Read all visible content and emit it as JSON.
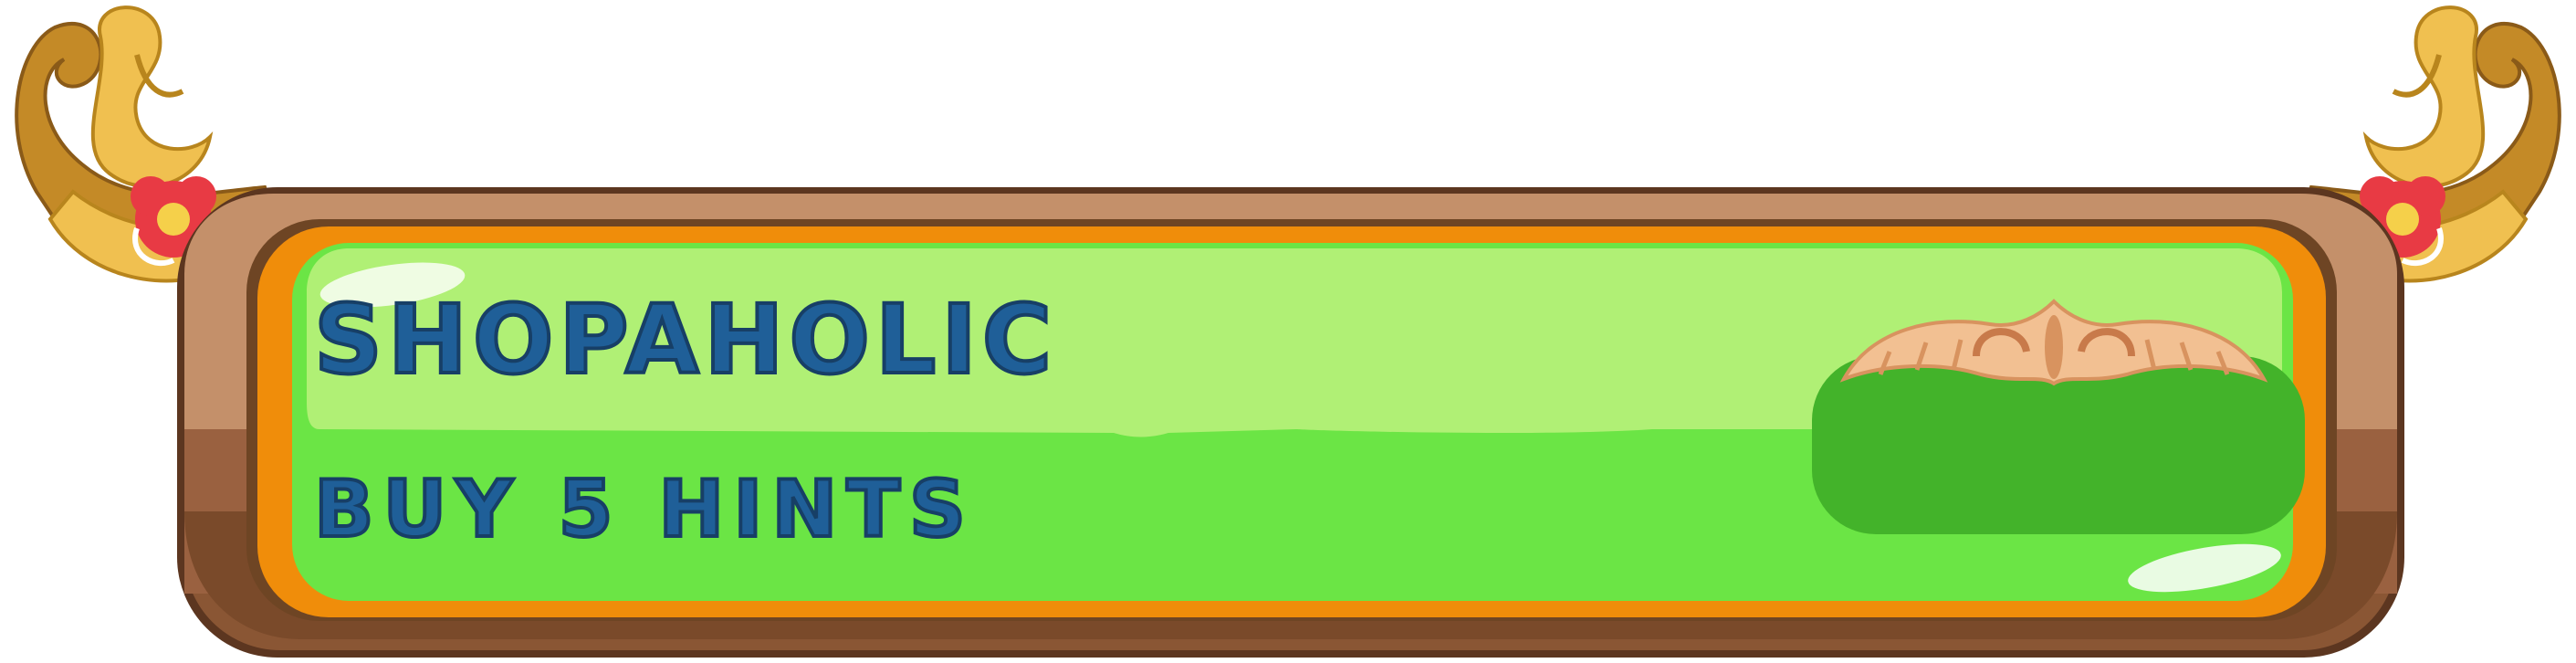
{
  "achievement": {
    "title": "SHOPAHOLIC",
    "description": "BUY 5 HINTS"
  },
  "colors": {
    "text": "#1f5f98",
    "text_outline": "#173f66",
    "wood_outer": "#8a5634",
    "wood_light": "#c4906a",
    "orange_rim": "#f08d0a",
    "green_main": "#6be545",
    "green_highlight": "#b0f075",
    "green_dark_slot": "#43b32a",
    "ornament_gold": "#f0c050",
    "ornament_dark_gold": "#c48a27",
    "flower_red": "#e83a44",
    "carving_peach": "#f2c092"
  },
  "icons": [
    "left-ornament-icon",
    "right-ornament-icon",
    "crest-icon"
  ]
}
